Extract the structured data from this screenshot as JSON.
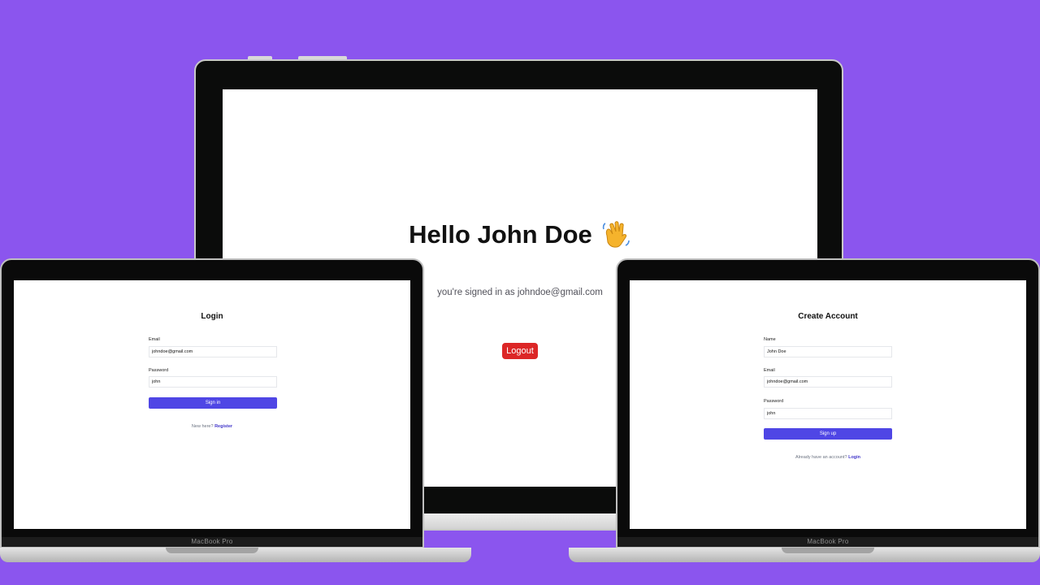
{
  "monitor": {
    "greeting": "Hello John Doe",
    "signed_in_text": "you're signed in as johndoe@gmail.com",
    "logout_label": "Logout",
    "greeting_icon": "waving-hand-icon"
  },
  "login_laptop": {
    "brand": "MacBook Pro",
    "title": "Login",
    "email_label": "Email",
    "email_value": "johndoe@gmail.com",
    "password_label": "Password",
    "password_value": "john",
    "submit_label": "Sign in",
    "footer_text": "New here?",
    "footer_link": "Register"
  },
  "register_laptop": {
    "brand": "MacBook Pro",
    "title": "Create Account",
    "name_label": "Name",
    "name_value": "John Doe",
    "email_label": "Email",
    "email_value": "johndoe@gmail.com",
    "password_label": "Password",
    "password_value": "john",
    "submit_label": "Sign up",
    "footer_text": "Already have an account?",
    "footer_link": "Login"
  },
  "colors": {
    "background": "#8b55ee",
    "primary": "#4f46e5",
    "logout": "#dc2626"
  }
}
